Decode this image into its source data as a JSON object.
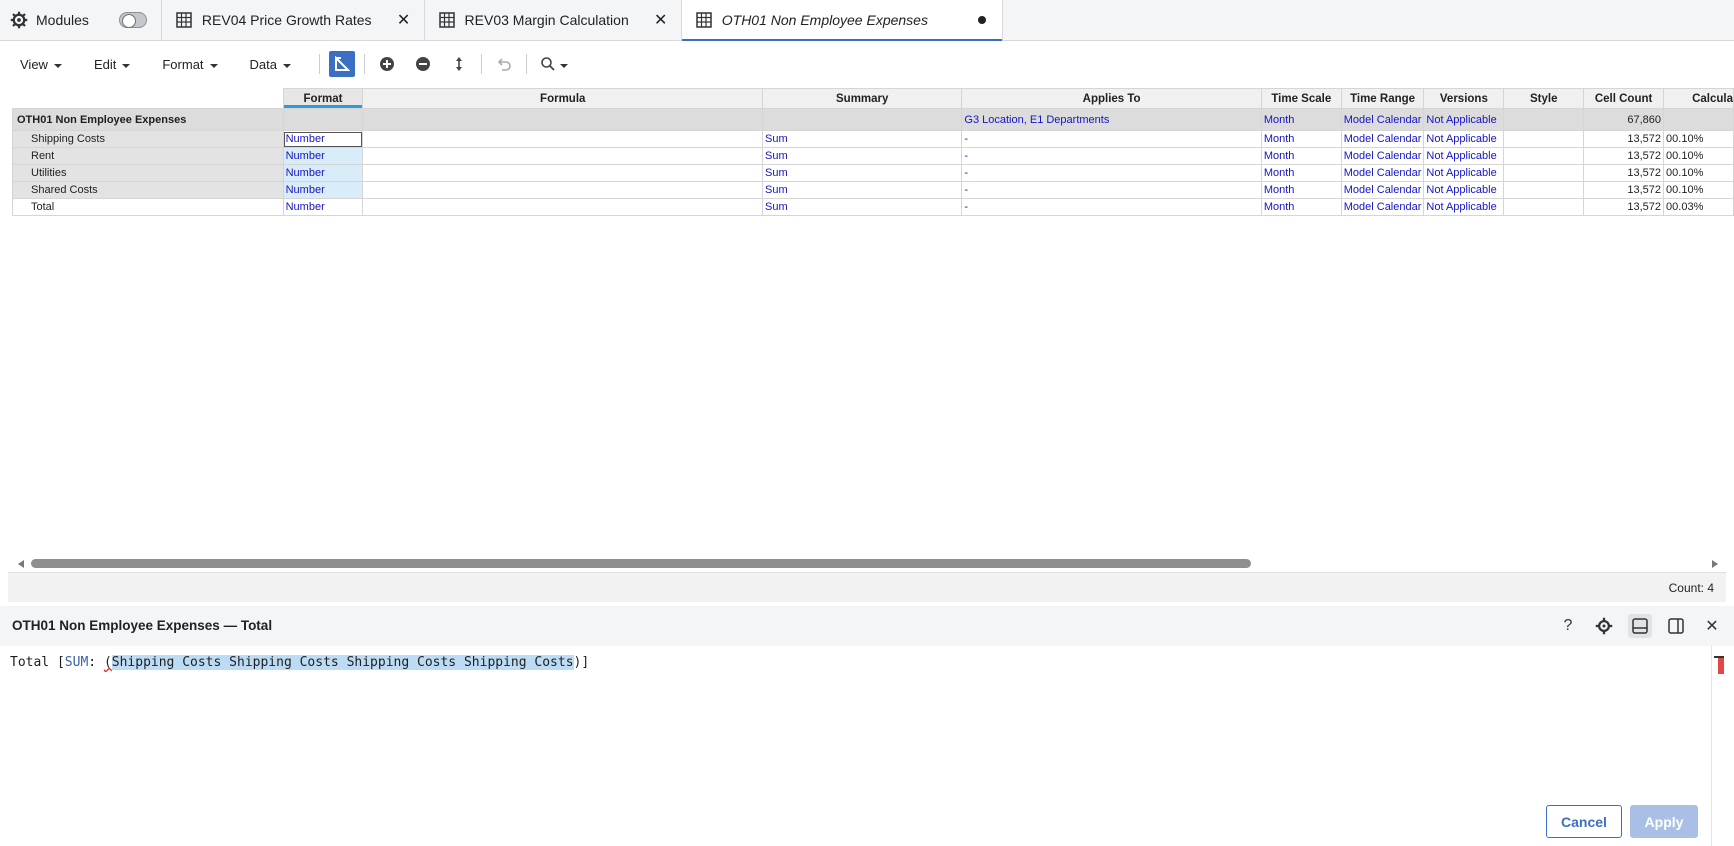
{
  "tabs": {
    "modules_label": "Modules",
    "items": [
      {
        "label": "REV04 Price Growth Rates",
        "state": "closable"
      },
      {
        "label": "REV03 Margin Calculation",
        "state": "closable"
      },
      {
        "label": "OTH01 Non Employee Expenses",
        "state": "unsaved"
      }
    ]
  },
  "toolbar": {
    "view": "View",
    "edit": "Edit",
    "format": "Format",
    "data": "Data"
  },
  "grid": {
    "columns": [
      "Format",
      "Formula",
      "Summary",
      "Applies To",
      "Time Scale",
      "Time Range",
      "Versions",
      "Style",
      "Cell Count",
      "Calcula"
    ],
    "module_row": {
      "label": "OTH01 Non Employee Expenses",
      "format": "",
      "formula": "",
      "summary": "",
      "applies_to": "G3 Location, E1 Departments",
      "time_scale": "Month",
      "time_range": "Model Calendar",
      "versions": "Not Applicable",
      "style": "",
      "cell_count": "67,860",
      "calc": ""
    },
    "rows": [
      {
        "label": "Shipping Costs",
        "format": "Number",
        "formula": "",
        "summary": "Sum",
        "applies_to": "-",
        "time_scale": "Month",
        "time_range": "Model Calendar",
        "versions": "Not Applicable",
        "style": "",
        "cell_count": "13,572",
        "calc": "00.10%"
      },
      {
        "label": "Rent",
        "format": "Number",
        "formula": "",
        "summary": "Sum",
        "applies_to": "-",
        "time_scale": "Month",
        "time_range": "Model Calendar",
        "versions": "Not Applicable",
        "style": "",
        "cell_count": "13,572",
        "calc": "00.10%"
      },
      {
        "label": "Utilities",
        "format": "Number",
        "formula": "",
        "summary": "Sum",
        "applies_to": "-",
        "time_scale": "Month",
        "time_range": "Model Calendar",
        "versions": "Not Applicable",
        "style": "",
        "cell_count": "13,572",
        "calc": "00.10%"
      },
      {
        "label": "Shared Costs",
        "format": "Number",
        "formula": "",
        "summary": "Sum",
        "applies_to": "-",
        "time_scale": "Month",
        "time_range": "Model Calendar",
        "versions": "Not Applicable",
        "style": "",
        "cell_count": "13,572",
        "calc": "00.10%"
      },
      {
        "label": "Total",
        "format": "Number",
        "formula": "",
        "summary": "Sum",
        "applies_to": "-",
        "time_scale": "Month",
        "time_range": "Model Calendar",
        "versions": "Not Applicable",
        "style": "",
        "cell_count": "13,572",
        "calc": "00.03%"
      }
    ]
  },
  "status": {
    "count": "Count: 4"
  },
  "editor": {
    "title": "OTH01 Non Employee Expenses — Total",
    "code_prefix": "Total [",
    "code_fn": "SUM",
    "code_colon": ": ",
    "code_open": "(",
    "code_selected": "Shipping Costs Shipping Costs Shipping Costs Shipping Costs",
    "code_suffix": ")]",
    "help_icon": "?",
    "close_icon": "✕",
    "cancel_label": "Cancel",
    "apply_label": "Apply"
  },
  "colors": {
    "accent": "#3a6fc4",
    "selection": "#2e9bd6",
    "link_text": "#1414c8"
  }
}
